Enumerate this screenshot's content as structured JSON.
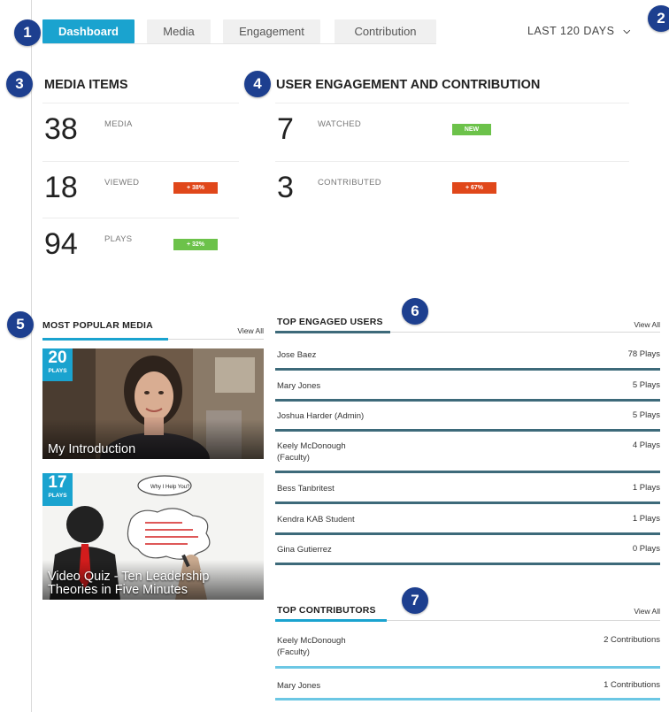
{
  "markers": [
    "1",
    "2",
    "3",
    "4",
    "5",
    "6",
    "7"
  ],
  "tabs": [
    {
      "label": "Dashboard",
      "active": true
    },
    {
      "label": "Media",
      "active": false
    },
    {
      "label": "Engagement",
      "active": false
    },
    {
      "label": "Contribution",
      "active": false
    }
  ],
  "date_range": {
    "label": "LAST 120 DAYS",
    "icon": "chevron-down-icon"
  },
  "media_items": {
    "title": "MEDIA ITEMS",
    "stats": [
      {
        "value": "38",
        "label": "MEDIA",
        "badge": null
      },
      {
        "value": "18",
        "label": "VIEWED",
        "badge": {
          "text": "+ 38%",
          "color": "#e0471a"
        }
      },
      {
        "value": "94",
        "label": "PLAYS",
        "badge": {
          "text": "+ 32%",
          "color": "#6cc24a"
        }
      }
    ]
  },
  "user_engagement": {
    "title": "USER ENGAGEMENT AND CONTRIBUTION",
    "stats": [
      {
        "value": "7",
        "label": "WATCHED",
        "badge": {
          "text": "NEW",
          "color": "#6cc24a"
        }
      },
      {
        "value": "3",
        "label": "CONTRIBUTED",
        "badge": {
          "text": "+ 67%",
          "color": "#e0471a"
        }
      }
    ]
  },
  "popular_media": {
    "title": "MOST POPULAR MEDIA",
    "view_all": "View All",
    "items": [
      {
        "plays": "20",
        "plays_label": "PLAYS",
        "title": "My Introduction"
      },
      {
        "plays": "17",
        "plays_label": "PLAYS",
        "title": "Video Quiz - Ten Leadership Theories in Five Minutes"
      }
    ]
  },
  "top_engaged_users": {
    "title": "TOP ENGAGED USERS",
    "view_all": "View All",
    "rows": [
      {
        "name": "Jose Baez",
        "value": "78 Plays"
      },
      {
        "name": "Mary Jones",
        "value": "5 Plays"
      },
      {
        "name": "Joshua Harder (Admin)",
        "value": "5 Plays"
      },
      {
        "name": "Keely McDonough (Faculty)",
        "value": "4 Plays"
      },
      {
        "name": "Bess Tanbritest",
        "value": "1 Plays"
      },
      {
        "name": "Kendra KAB Student",
        "value": "1 Plays"
      },
      {
        "name": "Gina Gutierrez",
        "value": "0 Plays"
      }
    ]
  },
  "top_contributors": {
    "title": "TOP CONTRIBUTORS",
    "view_all": "View All",
    "rows": [
      {
        "name": "Keely McDonough (Faculty)",
        "value": "2 Contributions"
      },
      {
        "name": "Mary Jones",
        "value": "1 Contributions"
      }
    ]
  },
  "colors": {
    "accent": "#1aa3cf",
    "dark_accent": "#3d6a7a",
    "marker": "#1d3f8f"
  }
}
